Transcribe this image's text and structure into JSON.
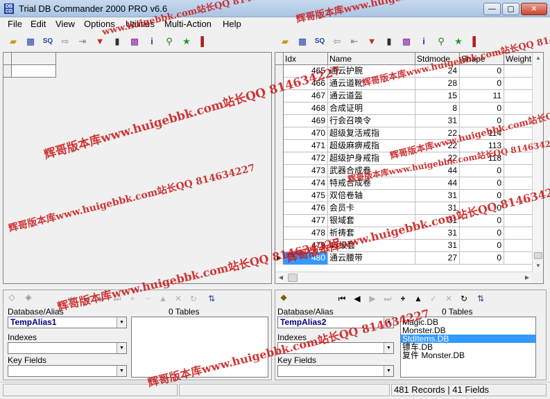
{
  "window": {
    "title": "Trial DB Commander 2000 PRO v6.6",
    "app_icon": "database-icon",
    "min_label": "—",
    "max_label": "▢",
    "close_label": "✕"
  },
  "menu": [
    "File",
    "Edit",
    "View",
    "Options",
    "Utilities",
    "Multi-Action",
    "Help"
  ],
  "toolbar_icons": [
    "open-folder-icon",
    "table-icon",
    "sql-icon",
    "arrow-right-icon",
    "export-icon",
    "filter-icon",
    "delete-icon",
    "sql-query-icon",
    "info-icon",
    "search-icon",
    "run-icon",
    "exit-icon"
  ],
  "grid": {
    "columns": [
      "Idx",
      "Name",
      "Stdmode",
      "Shape",
      "Weight"
    ],
    "rows": [
      {
        "idx": "465",
        "name": "通云护腕",
        "stdmode": "24",
        "shape": "0"
      },
      {
        "idx": "466",
        "name": "通云道靴",
        "stdmode": "28",
        "shape": "0"
      },
      {
        "idx": "467",
        "name": "通云道盔",
        "stdmode": "15",
        "shape": "11"
      },
      {
        "idx": "468",
        "name": "合成证明",
        "stdmode": "8",
        "shape": "0"
      },
      {
        "idx": "469",
        "name": "行会召唤令",
        "stdmode": "31",
        "shape": "0"
      },
      {
        "idx": "470",
        "name": "超级复活戒指",
        "stdmode": "22",
        "shape": "114"
      },
      {
        "idx": "471",
        "name": "超级麻痹戒指",
        "stdmode": "22",
        "shape": "113"
      },
      {
        "idx": "472",
        "name": "超级护身戒指",
        "stdmode": "22",
        "shape": "118"
      },
      {
        "idx": "473",
        "name": "武器合成卷",
        "stdmode": "44",
        "shape": "0"
      },
      {
        "idx": "474",
        "name": "特戒合成卷",
        "stdmode": "44",
        "shape": "0"
      },
      {
        "idx": "475",
        "name": "双倍卷轴",
        "stdmode": "31",
        "shape": "0"
      },
      {
        "idx": "476",
        "name": "会员卡",
        "stdmode": "31",
        "shape": "0"
      },
      {
        "idx": "477",
        "name": "银域套",
        "stdmode": "31",
        "shape": "0"
      },
      {
        "idx": "478",
        "name": "祈祷套",
        "stdmode": "31",
        "shape": "0"
      },
      {
        "idx": "479",
        "name": "45级套",
        "stdmode": "31",
        "shape": "0"
      },
      {
        "idx": "480",
        "name": "通云腰带",
        "stdmode": "27",
        "shape": "0"
      }
    ],
    "selected_row": "480",
    "current_marker": "▶"
  },
  "left_panel": {
    "db_alias_label": "Database/Alias",
    "db_alias_value": "TempAlias1",
    "tables_label": "0 Tables",
    "indexes_label": "Indexes",
    "key_fields_label": "Key Fields"
  },
  "right_panel": {
    "db_alias_label": "Database/Alias",
    "db_alias_value": "TempAlias2",
    "tables_label": "0 Tables",
    "indexes_label": "Indexes",
    "key_fields_label": "Key Fields",
    "tables": [
      "Magic.DB",
      "Monster.DB",
      "StdItems.DB",
      "镖车.DB",
      "复件 Monster.DB"
    ],
    "selected_table": "StdItems.DB"
  },
  "nav_glyphs": {
    "first": "⏮",
    "prior": "◀",
    "next": "▶",
    "last": "⏭",
    "insert": "+",
    "delete": "−",
    "edit": "▲",
    "post": "✓",
    "cancel": "✕",
    "refresh": "↻"
  },
  "status": {
    "records": "481 Records | 41 Fields"
  },
  "watermarks": [
    "辉哥版本库www.huigebbk.com",
    "www.huigebbk.com站长QQ 814634227",
    "辉哥版本库www.huigebbk.com站长QQ 814634227",
    "辉哥版本库www.huigebbk.com站长QQ 814634227",
    "辉哥版本库www.huigebbk.com站长QQ 814634227",
    "辉哥版本库www.huigebbk.com站长QQ 814634227",
    "辉哥版本库www.huigebbk.com站长QQ 814634227",
    "辉哥版本库www.huigebbk.com站长QQ 814634227",
    "辉哥版本库www.huigebbk.com站长QQ 814634227",
    "辉哥版本库www.huigebbk.com站长QQ 814634227"
  ]
}
